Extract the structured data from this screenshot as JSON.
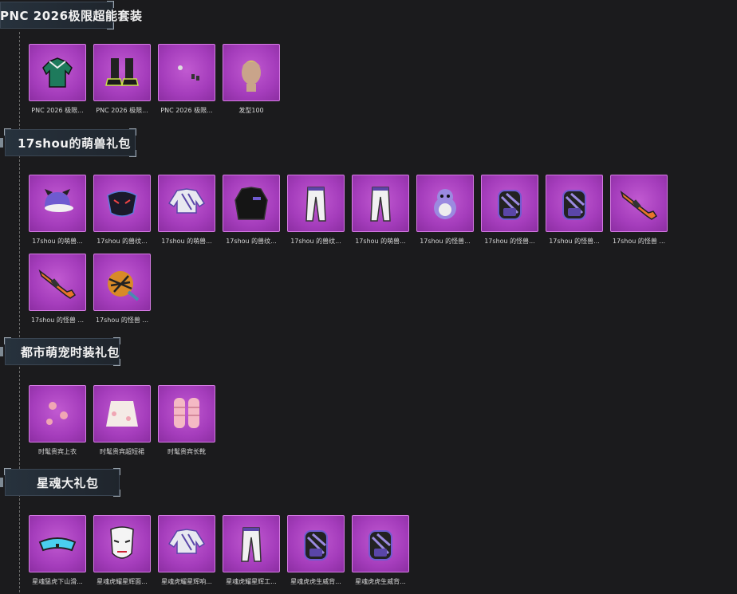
{
  "sections": [
    {
      "title": "PNC 2026极限超能套装",
      "items": [
        {
          "label": "PNC 2026 极限...",
          "icon": "jacket-icon"
        },
        {
          "label": "PNC 2026 极限...",
          "icon": "shoes-icon"
        },
        {
          "label": "PNC 2026 极限...",
          "icon": "earring-icon"
        },
        {
          "label": "发型100",
          "icon": "hair-head-icon"
        }
      ]
    },
    {
      "title": "17shou的萌兽礼包",
      "items": [
        {
          "label": "17shou 的萌兽...",
          "icon": "cap-icon"
        },
        {
          "label": "17shou 的兽纹...",
          "icon": "mask-icon"
        },
        {
          "label": "17shou 的萌兽...",
          "icon": "crop-jacket-icon"
        },
        {
          "label": "17shou 的兽纹...",
          "icon": "coat-icon"
        },
        {
          "label": "17shou 的兽纹...",
          "icon": "pants-icon"
        },
        {
          "label": "17shou 的萌兽...",
          "icon": "pants-icon"
        },
        {
          "label": "17shou 的怪兽...",
          "icon": "creature-icon"
        },
        {
          "label": "17shou 的怪兽...",
          "icon": "backpack-icon"
        },
        {
          "label": "17shou 的怪兽...",
          "icon": "backpack-icon"
        },
        {
          "label": "17shou 的怪兽 ...",
          "icon": "rifle-icon"
        },
        {
          "label": "17shou 的怪兽 ...",
          "icon": "rifle-icon"
        },
        {
          "label": "17shou 的怪兽 ...",
          "icon": "pan-icon"
        }
      ]
    },
    {
      "title": "都市萌宠时装礼包",
      "items": [
        {
          "label": "时髦贵宾上衣",
          "icon": "bow-top-icon"
        },
        {
          "label": "时髦贵宾超短裙",
          "icon": "skirt-icon"
        },
        {
          "label": "时髦贵宾长靴",
          "icon": "boots-icon"
        }
      ]
    },
    {
      "title": "星魂大礼包",
      "items": [
        {
          "label": "星魂猛虎下山滑...",
          "icon": "goggles-icon"
        },
        {
          "label": "星魂虎耀星辉面...",
          "icon": "face-mask-icon"
        },
        {
          "label": "星魂虎耀星辉响...",
          "icon": "crop-jacket-icon"
        },
        {
          "label": "星魂虎耀星辉工...",
          "icon": "pants-icon"
        },
        {
          "label": "星魂虎虎生威背...",
          "icon": "backpack-icon"
        },
        {
          "label": "星魂虎虎生威背...",
          "icon": "backpack-icon"
        }
      ]
    }
  ],
  "colors": {
    "background": "#1b1b1d",
    "tile": "#a53dbc",
    "tile_border": "#d47be2",
    "header_bg": "#27323d"
  }
}
